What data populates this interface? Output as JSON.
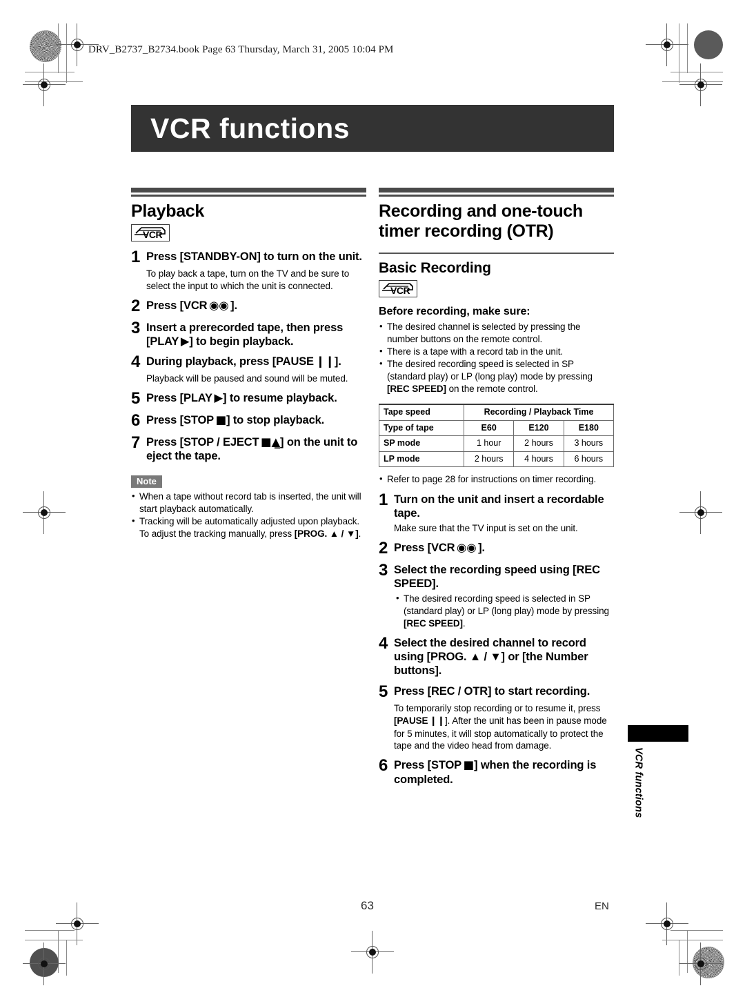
{
  "print_header": "DRV_B2737_B2734.book  Page 63  Thursday, March 31, 2005  10:04 PM",
  "chapter": {
    "title": "VCR functions"
  },
  "side_tab": {
    "label": "VCR functions"
  },
  "footer": {
    "page_number": "63",
    "language": "EN"
  },
  "badge": {
    "vcr_label": "VCR",
    "note_label": "Note"
  },
  "left_column": {
    "section_title": "Playback",
    "steps": [
      {
        "num": "1",
        "text": "Press [STANDBY-ON] to turn on the unit.",
        "body": "To play back a tape, turn on the TV and be sure to select the input to which the unit is connected."
      },
      {
        "num": "2",
        "text_before": "Press [VCR",
        "text_after": "].",
        "symbol": "reel-icon"
      },
      {
        "num": "3",
        "text_before": "Insert a prerecorded tape, then press [PLAY",
        "text_after": "] to begin playback.",
        "symbol": "play-icon"
      },
      {
        "num": "4",
        "text_before": "During playback, press [PAUSE",
        "text_after": "].",
        "symbol": "pause-icon",
        "body": "Playback will be paused and sound will be muted."
      },
      {
        "num": "5",
        "text_before": "Press [PLAY",
        "text_after": "] to resume playback.",
        "symbol": "play-icon"
      },
      {
        "num": "6",
        "text_before": "Press [STOP",
        "text_after": "] to stop playback.",
        "symbol": "stop-icon"
      },
      {
        "num": "7",
        "text_before": "Press [STOP / EJECT",
        "text_after": "] on the unit to eject the tape.",
        "symbol": "stop-eject-icon"
      }
    ],
    "note_bullets": [
      "When a tape without record tab is inserted, the unit will start playback automatically."
    ],
    "note_tracking_pre": "Tracking will be automatically adjusted upon playback. To adjust the tracking manually, press ",
    "note_tracking_bold": "[PROG. ▲ / ▼]",
    "note_tracking_post": "."
  },
  "right_column": {
    "section_title": "Recording and one-touch timer recording (OTR)",
    "subsection_title": "Basic Recording",
    "before_recording_heading": "Before recording, make sure:",
    "before_recording_bullets": [
      "The desired channel is selected by pressing the number buttons on the remote control.",
      "There is a tape with a record tab in the unit."
    ],
    "speed_bullet_pre": "The desired recording speed is selected in SP (standard play) or LP (long play) mode by pressing ",
    "speed_bullet_bold": "[REC SPEED]",
    "speed_bullet_post": " on the remote control.",
    "refer_bullet": "Refer to page 28 for instructions on timer recording.",
    "steps": [
      {
        "num": "1",
        "text": "Turn on the unit and insert a recordable tape.",
        "body": "Make sure that the TV input is set on the unit."
      },
      {
        "num": "2",
        "text_before": "Press [VCR",
        "text_after": "].",
        "symbol": "reel-icon"
      },
      {
        "num": "3",
        "text": "Select the recording speed using [REC SPEED].",
        "sub_bullet_pre": "The desired recording speed is selected in SP (standard play) or LP (long play) mode by pressing ",
        "sub_bullet_bold": "[REC SPEED]",
        "sub_bullet_post": "."
      },
      {
        "num": "4",
        "text": "Select the desired channel to record using [PROG. ▲ / ▼] or [the Number buttons]."
      },
      {
        "num": "5",
        "text": "Press [REC / OTR] to start recording.",
        "body_pre": "To temporarily stop recording or to resume it, press ",
        "body_bold": "[PAUSE",
        "body_post": "]. After the unit has been in pause mode for 5 minutes, it will stop automatically to protect the tape and the video head from damage."
      },
      {
        "num": "6",
        "text_before": "Press [STOP",
        "text_after": "] when the recording is completed.",
        "symbol": "stop-icon"
      }
    ]
  },
  "tape_table": {
    "header_row_1": {
      "label": "Tape speed",
      "span_label": "Recording / Playback Time"
    },
    "header_row_2": {
      "label": "Type of tape",
      "columns": [
        "E60",
        "E120",
        "E180"
      ]
    },
    "rows": [
      {
        "label": "SP mode",
        "values": [
          "1 hour",
          "2 hours",
          "3 hours"
        ]
      },
      {
        "label": "LP mode",
        "values": [
          "2 hours",
          "4 hours",
          "6 hours"
        ]
      }
    ]
  }
}
